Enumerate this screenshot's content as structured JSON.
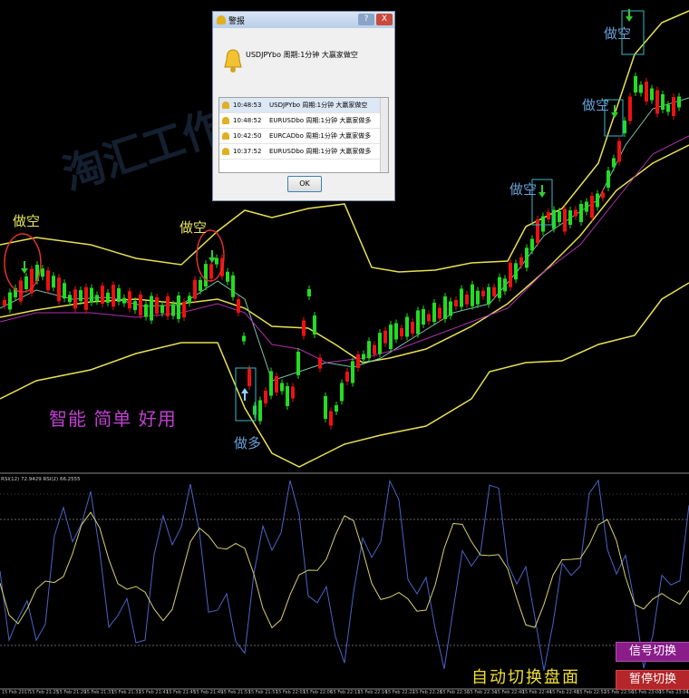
{
  "watermark": "淘汇工作室",
  "slogan": "智能   简单   好用",
  "labels": {
    "short_1": "做空",
    "short_2": "做空",
    "long_1": "做多",
    "short_3": "做空",
    "short_4": "做空",
    "short_5": "做空"
  },
  "alert": {
    "title": "警报",
    "help_label": "?",
    "close_label": "X",
    "message": "USDJPYbo 周期:1分钟 大赢家做空",
    "ok_label": "OK",
    "rows": [
      {
        "time": "10:48:53",
        "text": "USDJPYbo 周期:1分钟 大赢家做空"
      },
      {
        "time": "10:48:52",
        "text": "EURUSDbo 周期:1分钟 大赢家做多"
      },
      {
        "time": "10:42:50",
        "text": "EURCADbo 周期:1分钟 大赢家做多"
      },
      {
        "time": "10:37:52",
        "text": "EURUSDbo 周期:1分钟 大赢家做多"
      }
    ]
  },
  "rsi": {
    "header": "RSI(12) 72.9429  RSI(2) 66.2555"
  },
  "time_axis": [
    "15 Feb 2017",
    "15 Feb 21:25",
    "15 Feb 21:29",
    "15 Feb 21:33",
    "15 Feb 21:37",
    "15 Feb 21:41",
    "15 Feb 21:45",
    "15 Feb 21:49",
    "15 Feb 21:53",
    "15 Feb 21:57",
    "15 Feb 22:01",
    "15 Feb 22:06",
    "15 Feb 22:11",
    "15 Feb 22:16",
    "15 Feb 22:22",
    "15 Feb 22:26",
    "15 Feb 22:30",
    "15 Feb 22:34",
    "15 Feb 22:40",
    "15 Feb 22:44",
    "15 Feb 22:48",
    "15 Feb 22:52",
    "15 Feb 22:56",
    "15 Feb 23:00",
    "15 Feb 23:04",
    "15 Feb 2"
  ],
  "buttons": {
    "signal_switch": "信号切换",
    "pause_switch": "暂停切换"
  },
  "auto_text": "自动切换盘面",
  "colors": {
    "bull": "#22dd22",
    "bear": "#ee1111",
    "bands": "#e8e050",
    "ma_fast": "#7abfae",
    "ma_slow": "#b030b0",
    "rsi_fast": "#4d63c8",
    "rsi_slow": "#d8d070"
  }
}
